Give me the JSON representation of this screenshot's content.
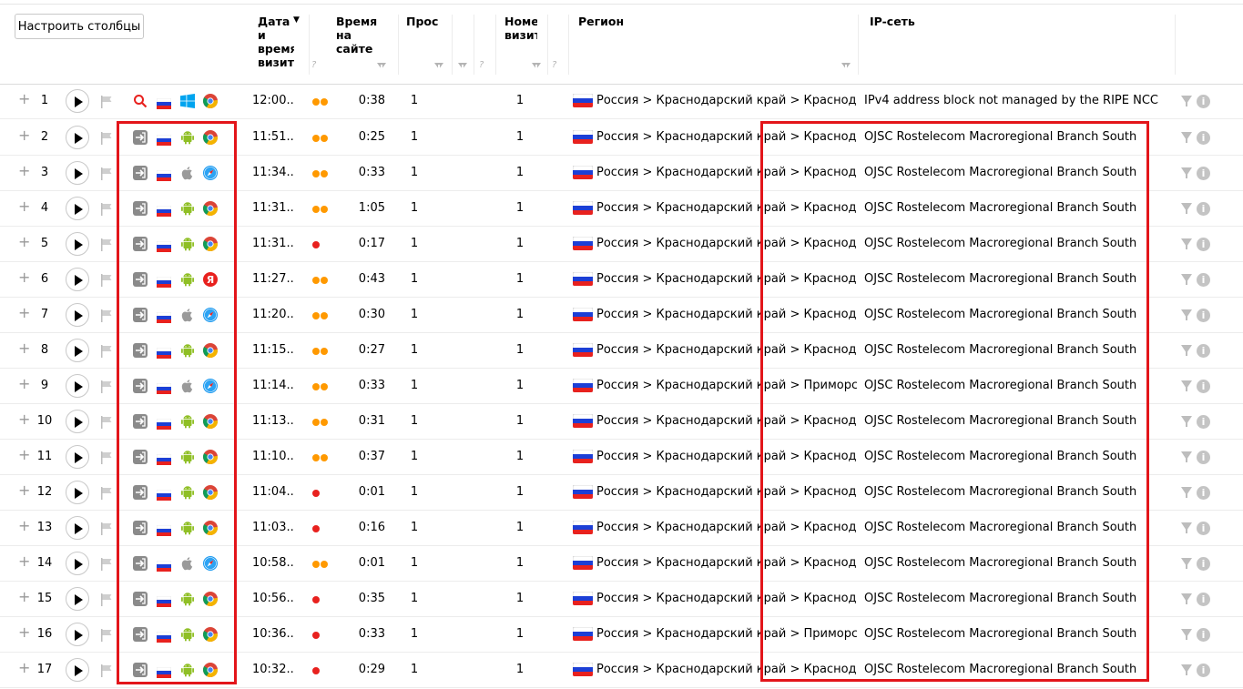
{
  "toolbar": {
    "configure_columns_label": "Настроить столбцы"
  },
  "columns": {
    "date_time": [
      "Дата",
      "и",
      "время",
      "визита"
    ],
    "time_on_site": [
      "Время",
      "на",
      "сайте"
    ],
    "pageviews": [
      "Просм"
    ],
    "visit_number": [
      "Номе",
      "визит"
    ],
    "region": "Регион",
    "ip_network": "IP-сеть"
  },
  "colors": {
    "highlight": "#e3151a",
    "dot_orange": "#ff9900",
    "dot_red": "#e8211e"
  },
  "icons": {
    "search": "search-icon",
    "direct": "direct-entry-icon",
    "russia_flag": "russia-flag-icon",
    "windows": "windows-icon",
    "android": "android-icon",
    "apple": "apple-icon",
    "chrome": "chrome-icon",
    "safari": "safari-icon",
    "yandex": "yandex-browser-icon"
  },
  "rows": [
    {
      "n": "1",
      "src": "search",
      "os": "windows",
      "browser": "chrome",
      "time": "12:00...",
      "dots": [
        "orange",
        "orange"
      ],
      "dur": "0:38",
      "pv": "1",
      "vn": "1",
      "region": "Россия > Краснодарский край > Краснодар",
      "ip": "IPv4 address block not managed by the RIPE NCC"
    },
    {
      "n": "2",
      "src": "direct",
      "os": "android",
      "browser": "chrome",
      "time": "11:51...",
      "dots": [
        "orange",
        "orange"
      ],
      "dur": "0:25",
      "pv": "1",
      "vn": "1",
      "region": "Россия > Краснодарский край > Краснодар",
      "ip": "OJSC Rostelecom Macroregional Branch South"
    },
    {
      "n": "3",
      "src": "direct",
      "os": "apple",
      "browser": "safari",
      "time": "11:34...",
      "dots": [
        "orange",
        "orange"
      ],
      "dur": "0:33",
      "pv": "1",
      "vn": "1",
      "region": "Россия > Краснодарский край > Краснодар",
      "ip": "OJSC Rostelecom Macroregional Branch South"
    },
    {
      "n": "4",
      "src": "direct",
      "os": "android",
      "browser": "chrome",
      "time": "11:31...",
      "dots": [
        "orange",
        "orange"
      ],
      "dur": "1:05",
      "pv": "1",
      "vn": "1",
      "region": "Россия > Краснодарский край > Краснодар",
      "ip": "OJSC Rostelecom Macroregional Branch South"
    },
    {
      "n": "5",
      "src": "direct",
      "os": "android",
      "browser": "chrome",
      "time": "11:31...",
      "dots": [
        "red"
      ],
      "dur": "0:17",
      "pv": "1",
      "vn": "1",
      "region": "Россия > Краснодарский край > Краснодар",
      "ip": "OJSC Rostelecom Macroregional Branch South"
    },
    {
      "n": "6",
      "src": "direct",
      "os": "android",
      "browser": "yandex",
      "time": "11:27...",
      "dots": [
        "orange",
        "orange"
      ],
      "dur": "0:43",
      "pv": "1",
      "vn": "1",
      "region": "Россия > Краснодарский край > Краснодар",
      "ip": "OJSC Rostelecom Macroregional Branch South"
    },
    {
      "n": "7",
      "src": "direct",
      "os": "apple",
      "browser": "safari",
      "time": "11:20...",
      "dots": [
        "orange",
        "orange"
      ],
      "dur": "0:30",
      "pv": "1",
      "vn": "1",
      "region": "Россия > Краснодарский край > Краснодар",
      "ip": "OJSC Rostelecom Macroregional Branch South"
    },
    {
      "n": "8",
      "src": "direct",
      "os": "android",
      "browser": "chrome",
      "time": "11:15...",
      "dots": [
        "orange",
        "orange"
      ],
      "dur": "0:27",
      "pv": "1",
      "vn": "1",
      "region": "Россия > Краснодарский край > Краснодар",
      "ip": "OJSC Rostelecom Macroregional Branch South"
    },
    {
      "n": "9",
      "src": "direct",
      "os": "apple",
      "browser": "safari",
      "time": "11:14...",
      "dots": [
        "orange",
        "orange"
      ],
      "dur": "0:33",
      "pv": "1",
      "vn": "1",
      "region": "Россия > Краснодарский край > Приморско-А...",
      "ip": "OJSC Rostelecom Macroregional Branch South"
    },
    {
      "n": "10",
      "src": "direct",
      "os": "android",
      "browser": "chrome",
      "time": "11:13...",
      "dots": [
        "orange",
        "orange"
      ],
      "dur": "0:31",
      "pv": "1",
      "vn": "1",
      "region": "Россия > Краснодарский край > Краснодар",
      "ip": "OJSC Rostelecom Macroregional Branch South"
    },
    {
      "n": "11",
      "src": "direct",
      "os": "android",
      "browser": "chrome",
      "time": "11:10...",
      "dots": [
        "orange",
        "orange"
      ],
      "dur": "0:37",
      "pv": "1",
      "vn": "1",
      "region": "Россия > Краснодарский край > Краснодар",
      "ip": "OJSC Rostelecom Macroregional Branch South"
    },
    {
      "n": "12",
      "src": "direct",
      "os": "android",
      "browser": "chrome",
      "time": "11:04...",
      "dots": [
        "red"
      ],
      "dur": "0:01",
      "pv": "1",
      "vn": "1",
      "region": "Россия > Краснодарский край > Краснодар",
      "ip": "OJSC Rostelecom Macroregional Branch South"
    },
    {
      "n": "13",
      "src": "direct",
      "os": "android",
      "browser": "chrome",
      "time": "11:03...",
      "dots": [
        "red"
      ],
      "dur": "0:16",
      "pv": "1",
      "vn": "1",
      "region": "Россия > Краснодарский край > Краснодар",
      "ip": "OJSC Rostelecom Macroregional Branch South"
    },
    {
      "n": "14",
      "src": "direct",
      "os": "apple",
      "browser": "safari",
      "time": "10:58...",
      "dots": [
        "orange",
        "orange"
      ],
      "dur": "0:01",
      "pv": "1",
      "vn": "1",
      "region": "Россия > Краснодарский край > Краснодар",
      "ip": "OJSC Rostelecom Macroregional Branch South"
    },
    {
      "n": "15",
      "src": "direct",
      "os": "android",
      "browser": "chrome",
      "time": "10:56...",
      "dots": [
        "red"
      ],
      "dur": "0:35",
      "pv": "1",
      "vn": "1",
      "region": "Россия > Краснодарский край > Краснодар",
      "ip": "OJSC Rostelecom Macroregional Branch South"
    },
    {
      "n": "16",
      "src": "direct",
      "os": "android",
      "browser": "chrome",
      "time": "10:36...",
      "dots": [
        "red"
      ],
      "dur": "0:33",
      "pv": "1",
      "vn": "1",
      "region": "Россия > Краснодарский край > Приморско-А...",
      "ip": "OJSC Rostelecom Macroregional Branch South"
    },
    {
      "n": "17",
      "src": "direct",
      "os": "android",
      "browser": "chrome",
      "time": "10:32...",
      "dots": [
        "red"
      ],
      "dur": "0:29",
      "pv": "1",
      "vn": "1",
      "region": "Россия > Краснодарский край > Краснодар",
      "ip": "OJSC Rostelecom Macroregional Branch South"
    }
  ]
}
